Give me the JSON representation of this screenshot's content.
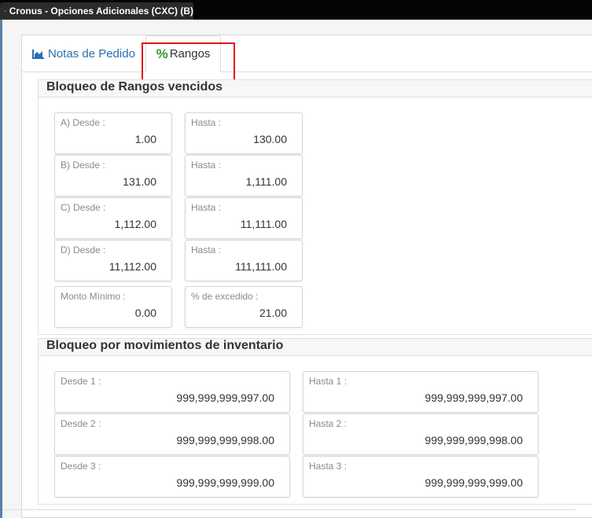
{
  "window": {
    "title": "Cronus - Opciones Adicionales (CXC) (B)"
  },
  "tabs": [
    {
      "label": "Notas de Pedido",
      "icon": "area-chart-icon",
      "active": false
    },
    {
      "label": "Rangos",
      "icon": "percent-icon",
      "active": true
    }
  ],
  "rangos": {
    "title": "Bloqueo de Rangos vencidos",
    "rows": [
      {
        "desde_label": "A) Desde :",
        "desde_value": "1.00",
        "hasta_label": "Hasta :",
        "hasta_value": "130.00"
      },
      {
        "desde_label": "B) Desde :",
        "desde_value": "131.00",
        "hasta_label": "Hasta :",
        "hasta_value": "1,111.00"
      },
      {
        "desde_label": "C) Desde :",
        "desde_value": "1,112.00",
        "hasta_label": "Hasta :",
        "hasta_value": "11,111.00"
      },
      {
        "desde_label": "D) Desde :",
        "desde_value": "11,112.00",
        "hasta_label": "Hasta :",
        "hasta_value": "111,111.00"
      }
    ],
    "monto_minimo_label": "Monto Mínimo :",
    "monto_minimo_value": "0.00",
    "excedido_label": "% de excedido :",
    "excedido_value": "21.00"
  },
  "inventario": {
    "title": "Bloqueo por movimientos de inventario",
    "rows": [
      {
        "desde_label": "Desde 1 :",
        "desde_value": "999,999,999,997.00",
        "hasta_label": "Hasta 1 :",
        "hasta_value": "999,999,999,997.00"
      },
      {
        "desde_label": "Desde 2 :",
        "desde_value": "999,999,999,998.00",
        "hasta_label": "Hasta 2 :",
        "hasta_value": "999,999,999,998.00"
      },
      {
        "desde_label": "Desde 3 :",
        "desde_value": "999,999,999,999.00",
        "hasta_label": "Hasta 3 :",
        "hasta_value": "999,999,999,999.00"
      }
    ]
  },
  "colors": {
    "accent": "#2a6fb0",
    "highlight": "#e0151c",
    "percent_icon": "#2e9a31"
  }
}
